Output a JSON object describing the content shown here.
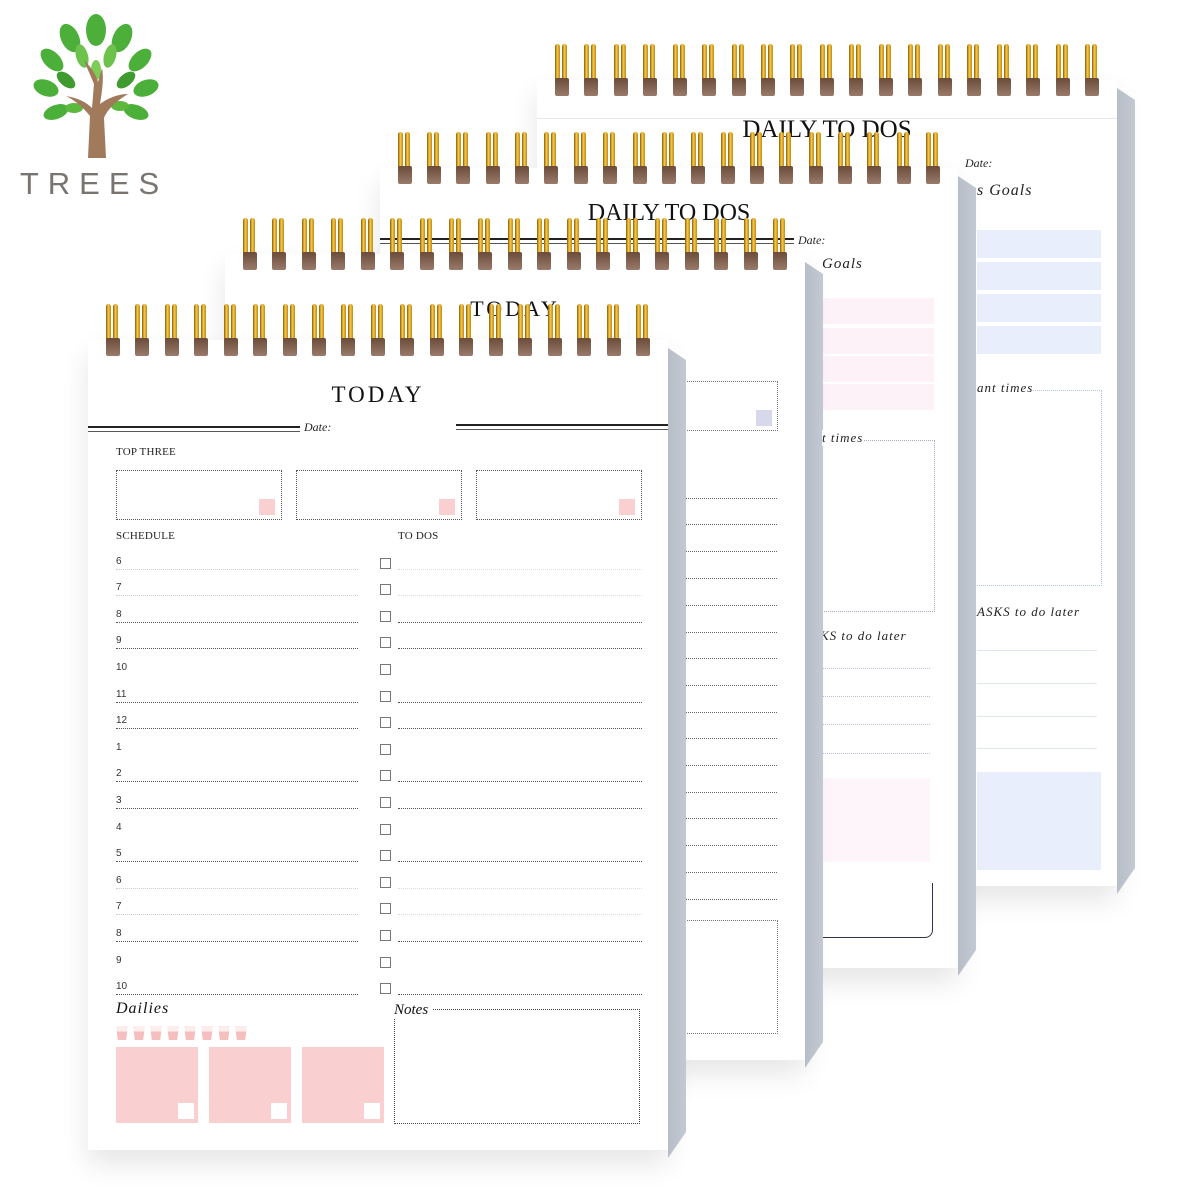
{
  "brand": {
    "name": "TREES",
    "logo_icon": "tree-icon",
    "colors": {
      "leaf": "#4caf3a",
      "trunk": "#a07a5a",
      "text": "#7a7471"
    }
  },
  "pads": {
    "today_front": {
      "title": "TODAY",
      "date_label": "Date:",
      "top_three_label": "TOP THREE",
      "schedule_label": "SCHEDULE",
      "todos_label": "TO DOS",
      "schedule_hours": [
        "6",
        "7",
        "8",
        "9",
        "10",
        "11",
        "12",
        "1",
        "2",
        "3",
        "4",
        "5",
        "6",
        "7",
        "8",
        "9",
        "10"
      ],
      "dailies_label": "Dailies",
      "notes_label": "Notes",
      "water_cups": 8,
      "accent": "#f9cfcf"
    },
    "today_back": {
      "title": "TODAY",
      "accent": "#d8d8ec"
    },
    "daily_todos_pink": {
      "title": "DAILY TO DOS",
      "date_label": "Date:",
      "goals_label": "Goals",
      "times_label": "t times",
      "later_label": "KS to do later",
      "accent": "#fdf2f7"
    },
    "daily_todos_blue": {
      "title": "DAILY TO DOS",
      "date_label": "Date:",
      "goals_label": "s Goals",
      "times_label": "ant times",
      "later_label": "ASKS to do later",
      "accent": "#e8eefc"
    }
  },
  "spiral": {
    "color": "#e3b53a",
    "rings_front": 19,
    "rings_back": 19
  }
}
